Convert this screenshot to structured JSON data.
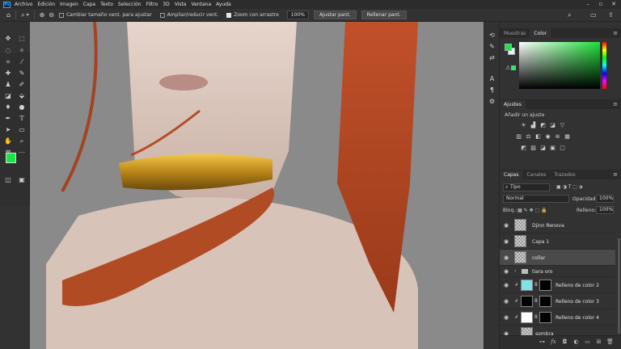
{
  "app": {
    "logo": "Ps"
  },
  "menu": [
    "Archivo",
    "Edición",
    "Imagen",
    "Capa",
    "Texto",
    "Selección",
    "Filtro",
    "3D",
    "Vista",
    "Ventana",
    "Ayuda"
  ],
  "options": {
    "resize_windows": "Cambiar tamaño vent. para ajustar",
    "zoom_all": "Ampliar/reducir vent.",
    "scrubby_zoom": "Zoom con arrastre",
    "zoom_value": "100%",
    "fit_screen": "Ajustar pant.",
    "fill_screen": "Rellenar pant."
  },
  "color_panel": {
    "tabs": [
      "Muestras",
      "Color"
    ],
    "active": "Color",
    "fg": "#15e843",
    "bg": "#d4fdf2"
  },
  "adjustments": {
    "tab": "Ajustes",
    "subtitle": "Añadir un ajuste"
  },
  "layers_panel": {
    "tabs": [
      "Capas",
      "Canales",
      "Trazados"
    ],
    "filter": "Tipo",
    "blend_mode": "Normal",
    "opacity_label": "Opacidad:",
    "opacity": "100%",
    "lock_label": "Bloq.:",
    "fill_label": "Relleno:",
    "fill": "100%",
    "layers": [
      {
        "name": "Djinn Renova",
        "kind": "pixel"
      },
      {
        "name": "Capa 1",
        "kind": "pixel"
      },
      {
        "name": "collar",
        "kind": "pixel",
        "selected": true
      },
      {
        "name": "tiara oro",
        "kind": "group"
      },
      {
        "name": "Relleno de color 2",
        "kind": "fill",
        "color": "#7ee3e8"
      },
      {
        "name": "Relleno de color 3",
        "kind": "fill",
        "color": "#000000"
      },
      {
        "name": "Relleno de color 4",
        "kind": "fill",
        "color": "#ffffff"
      },
      {
        "name": "sombra",
        "kind": "pixel"
      }
    ]
  }
}
